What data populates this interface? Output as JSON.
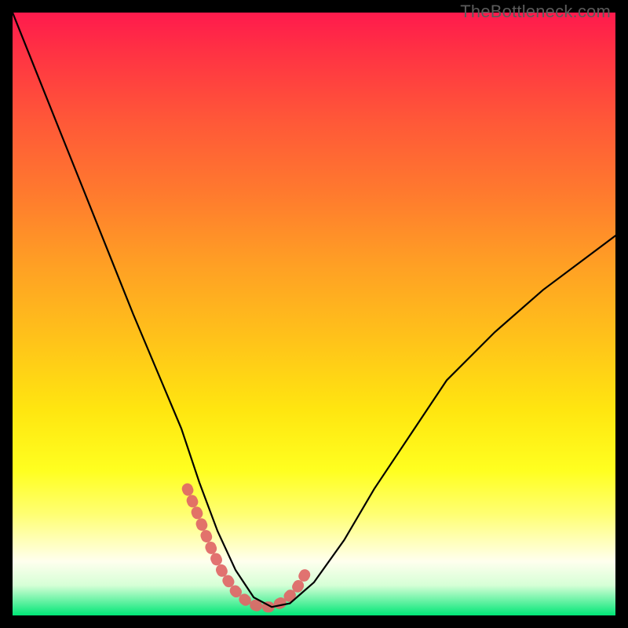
{
  "watermark": {
    "text": "TheBottleneck.com"
  },
  "chart_data": {
    "type": "line",
    "title": "",
    "xlabel": "",
    "ylabel": "",
    "xlim": [
      0,
      1
    ],
    "ylim": [
      0,
      1
    ],
    "background_gradient": {
      "orientation": "vertical",
      "stops": [
        {
          "pos": 0.0,
          "color": "#ff1a4d"
        },
        {
          "pos": 0.5,
          "color": "#ffc21a"
        },
        {
          "pos": 0.8,
          "color": "#ffff40"
        },
        {
          "pos": 0.97,
          "color": "#d6ffd6"
        },
        {
          "pos": 1.0,
          "color": "#00e676"
        }
      ]
    },
    "series": [
      {
        "name": "bottleneck-curve",
        "color": "#000000",
        "x": [
          0.0,
          0.04,
          0.08,
          0.12,
          0.16,
          0.2,
          0.24,
          0.28,
          0.31,
          0.34,
          0.37,
          0.4,
          0.43,
          0.46,
          0.5,
          0.55,
          0.6,
          0.66,
          0.72,
          0.8,
          0.88,
          1.0
        ],
        "y": [
          1.0,
          0.9,
          0.8,
          0.7,
          0.6,
          0.5,
          0.405,
          0.31,
          0.22,
          0.14,
          0.075,
          0.03,
          0.014,
          0.02,
          0.055,
          0.125,
          0.21,
          0.3,
          0.39,
          0.47,
          0.54,
          0.63
        ]
      },
      {
        "name": "highlight-segment",
        "color": "#e06666",
        "style": "dotted-thick",
        "x": [
          0.29,
          0.31,
          0.33,
          0.35,
          0.37,
          0.39,
          0.41,
          0.43,
          0.452,
          0.472,
          0.492
        ],
        "y": [
          0.21,
          0.16,
          0.11,
          0.068,
          0.04,
          0.022,
          0.014,
          0.014,
          0.024,
          0.046,
          0.08
        ]
      }
    ],
    "annotations": []
  }
}
